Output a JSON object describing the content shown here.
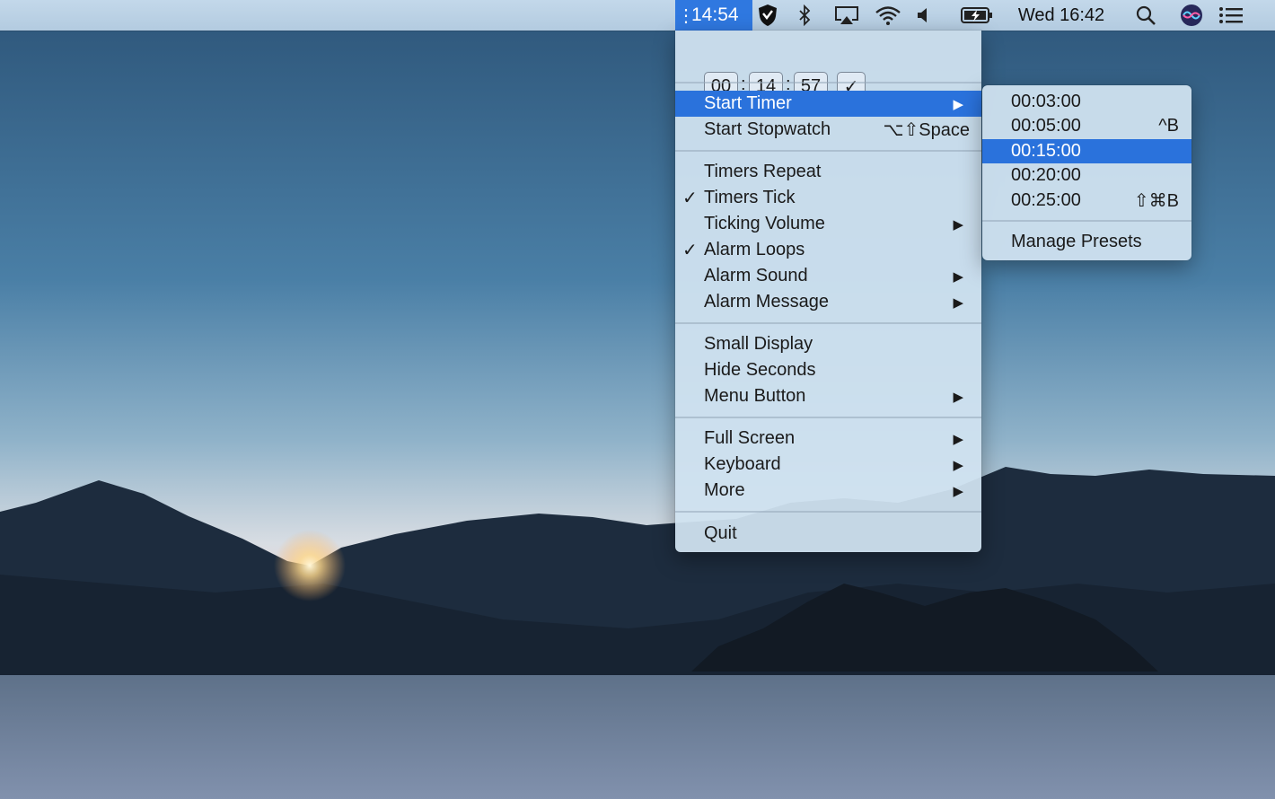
{
  "menubar": {
    "timer": "14:54",
    "clock": "Wed 16:42",
    "icons": [
      "drag-handle-icon",
      "shield-icon",
      "bluetooth-icon",
      "airplay-icon",
      "wifi-icon",
      "volume-icon",
      "battery-charging-icon",
      "spotlight-search-icon",
      "siri-icon",
      "notification-center-icon"
    ]
  },
  "timer_input": {
    "hours": "00",
    "minutes": "14",
    "seconds": "57",
    "separator": ":",
    "confirm_icon": "✓"
  },
  "menu": {
    "start_timer": "Start Timer",
    "start_stopwatch": "Start Stopwatch",
    "stopwatch_shortcut": "⌥⇧Space",
    "timers_repeat": "Timers Repeat",
    "timers_tick": "Timers Tick",
    "ticking_volume": "Ticking Volume",
    "alarm_loops": "Alarm Loops",
    "alarm_sound": "Alarm Sound",
    "alarm_message": "Alarm Message",
    "small_display": "Small Display",
    "hide_seconds": "Hide Seconds",
    "menu_button": "Menu Button",
    "full_screen": "Full Screen",
    "keyboard": "Keyboard",
    "more": "More",
    "quit": "Quit",
    "check_mark": "✓",
    "submenu_arrow": "▶"
  },
  "presets": {
    "items": [
      {
        "label": "00:03:00",
        "shortcut": ""
      },
      {
        "label": "00:05:00",
        "shortcut": "^B"
      },
      {
        "label": "00:15:00",
        "shortcut": ""
      },
      {
        "label": "00:20:00",
        "shortcut": ""
      },
      {
        "label": "00:25:00",
        "shortcut": "⇧⌘B"
      }
    ],
    "selected_index": 2,
    "manage": "Manage Presets"
  },
  "colors": {
    "highlight": "#2a72dc",
    "menubar_timer_bg": "#2f78e0"
  }
}
